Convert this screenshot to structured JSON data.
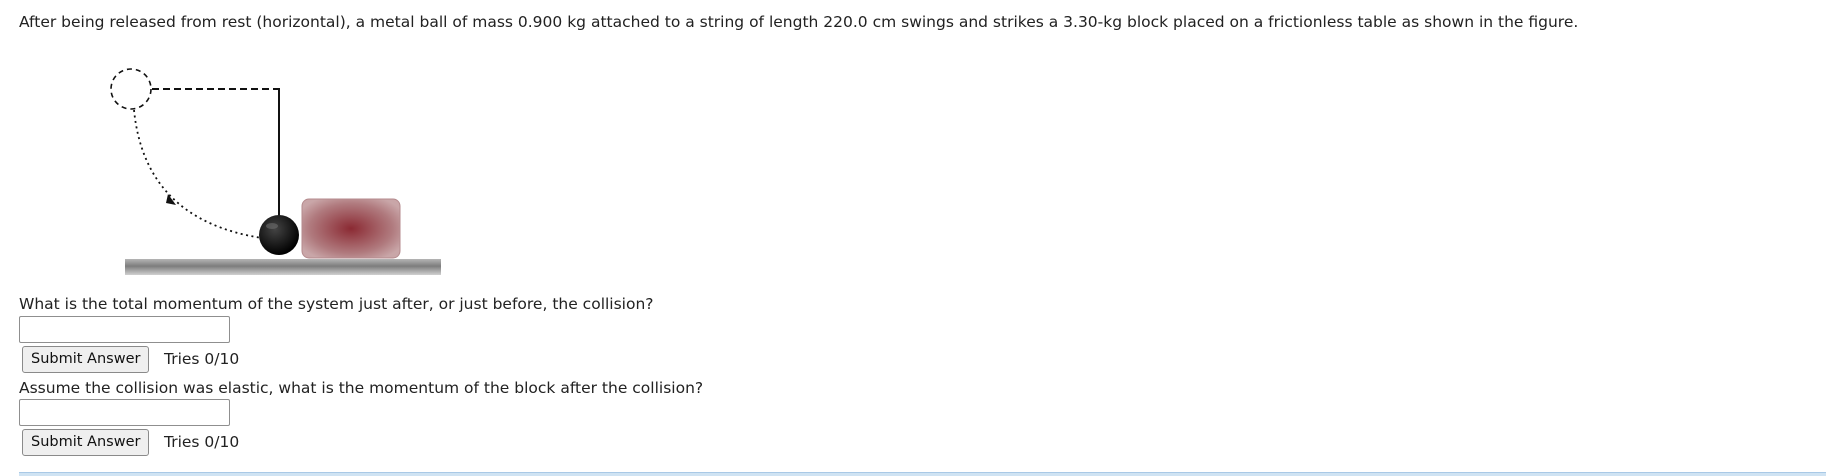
{
  "problem": {
    "text": "After being released from rest (horizontal), a metal ball of mass 0.900 kg attached to a string of length 220.0 cm swings and strikes a 3.30-kg block placed on a frictionless table as shown in the figure."
  },
  "questions": [
    {
      "prompt": "What is the total momentum of the system just after, or just before, the collision?",
      "input_value": "",
      "submit_label": "Submit Answer",
      "tries": "Tries 0/10"
    },
    {
      "prompt": "Assume the collision was elastic, what is the momentum of the block after the collision?",
      "input_value": "",
      "submit_label": "Submit Answer",
      "tries": "Tries 0/10"
    }
  ],
  "colors": {
    "text": "#222222",
    "block": "#9e5a5f",
    "table": "#8a8a8a",
    "ball": "#000000"
  }
}
